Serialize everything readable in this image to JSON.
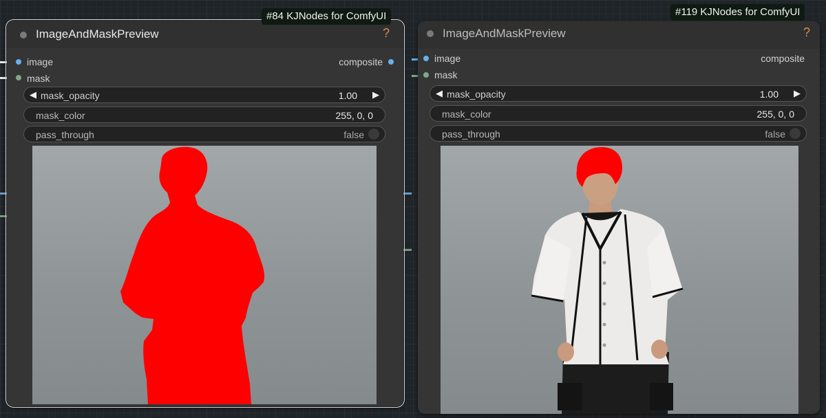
{
  "nodes": [
    {
      "badge": "#84 KJNodes for ComfyUI",
      "title": "ImageAndMaskPreview",
      "help": "?",
      "inputs": [
        {
          "name": "image"
        },
        {
          "name": "mask"
        }
      ],
      "output": "composite",
      "widgets": {
        "mask_opacity": {
          "label": "mask_opacity",
          "value": "1.00"
        },
        "mask_color": {
          "label": "mask_color",
          "value": "255, 0, 0"
        },
        "pass_through": {
          "label": "pass_through",
          "value": "false"
        }
      },
      "preview": "red mask silhouette of a standing person"
    },
    {
      "badge": "#119 KJNodes for ComfyUI",
      "title": "ImageAndMaskPreview",
      "help": "?",
      "inputs": [
        {
          "name": "image"
        },
        {
          "name": "mask"
        }
      ],
      "output": "composite",
      "widgets": {
        "mask_opacity": {
          "label": "mask_opacity",
          "value": "1.00"
        },
        "mask_color": {
          "label": "mask_color",
          "value": "255, 0, 0"
        },
        "pass_through": {
          "label": "pass_through",
          "value": "false"
        }
      },
      "preview": "man in white baseball jersey with red mask over hair"
    }
  ],
  "colors": {
    "mask": "#ff0000",
    "image_slot": "#6ab0e8",
    "mask_slot": "#7fa88a",
    "help": "#d88b4e",
    "node_bg": "#353535"
  },
  "icons": {
    "left_arrow": "◀",
    "right_arrow": "▶"
  }
}
